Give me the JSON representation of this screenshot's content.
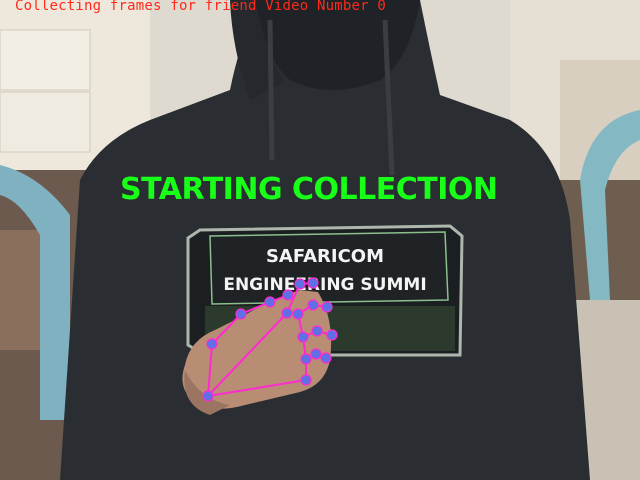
{
  "overlay": {
    "status_text": "Collecting frames for friend Video Number 0",
    "banner_text": "STARTING COLLECTION"
  },
  "hoodie_print": {
    "line1": "SAFARICOM",
    "line2": "ENGINEERING SUMMI"
  },
  "colors": {
    "status_text": "#ff2a1a",
    "banner_text": "#18ff18",
    "landmark_fill": "#5f6fe6",
    "landmark_connection": "#ff2ad0",
    "hoodie": "#2a2e33",
    "wall": "#e7e1d5"
  },
  "icons": {
    "hand_landmarks": "hand-skeleton-overlay"
  }
}
